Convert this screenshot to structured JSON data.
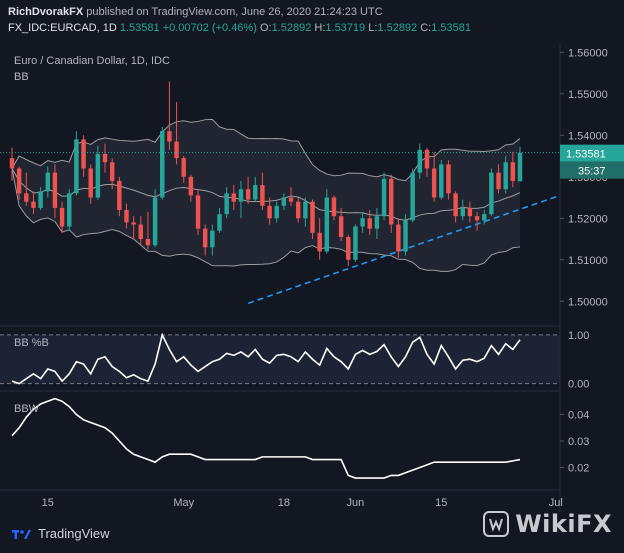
{
  "header": {
    "author": "RichDvorakFX",
    "published": "published on TradingView.com, June 26, 2020 21:24:23 UTC",
    "symbol": "FX_IDC:EURCAD, 1D",
    "last": "1.53581",
    "change": "+0.00702 (+0.46%)",
    "o_label": "O:",
    "o": "1.52892",
    "h_label": "H:",
    "h": "1.53719",
    "l_label": "L:",
    "l": "1.52892",
    "c_label": "C:",
    "c": "1.53581"
  },
  "footer": {
    "brand": "TradingView",
    "watermark": "WikiFX"
  },
  "colors": {
    "up": "#26a69a",
    "down": "#ef5350",
    "bands": "#c8c8c8",
    "trend": "#2196f3",
    "price_tag": "#26a69a",
    "bg": "#131722"
  },
  "chart_data": [
    {
      "type": "candlestick",
      "title": "Euro / Canadian Dollar, 1D, IDC",
      "indicator": "BB",
      "ylim": [
        1.495,
        1.562
      ],
      "yticks": [
        "1.56000",
        "1.55000",
        "1.54000",
        "1.53000",
        "1.52000",
        "1.51000",
        "1.50000"
      ],
      "last_price_label": "1.53581",
      "countdown_label": "35:37",
      "x_tick_labels": [
        "15",
        "May",
        "18",
        "Jun",
        "15",
        "Jul"
      ],
      "ohlc": [
        [
          1.5345,
          1.537,
          1.529,
          1.532
        ],
        [
          1.532,
          1.5325,
          1.5245,
          1.526
        ],
        [
          1.526,
          1.531,
          1.523,
          1.524
        ],
        [
          1.524,
          1.5265,
          1.521,
          1.5225
        ],
        [
          1.5225,
          1.5275,
          1.522,
          1.5265
        ],
        [
          1.5265,
          1.5325,
          1.525,
          1.531
        ],
        [
          1.531,
          1.533,
          1.52,
          1.5225
        ],
        [
          1.5225,
          1.524,
          1.5165,
          1.518
        ],
        [
          1.518,
          1.527,
          1.517,
          1.526
        ],
        [
          1.526,
          1.541,
          1.5255,
          1.539
        ],
        [
          1.539,
          1.54,
          1.53,
          1.532
        ],
        [
          1.532,
          1.533,
          1.5235,
          1.525
        ],
        [
          1.525,
          1.5375,
          1.5245,
          1.5355
        ],
        [
          1.5355,
          1.538,
          1.531,
          1.5335
        ],
        [
          1.5335,
          1.5345,
          1.527,
          1.529
        ],
        [
          1.529,
          1.53,
          1.5205,
          1.522
        ],
        [
          1.522,
          1.5235,
          1.5175,
          1.519
        ],
        [
          1.519,
          1.5205,
          1.515,
          1.5185
        ],
        [
          1.5185,
          1.5205,
          1.5135,
          1.515
        ],
        [
          1.515,
          1.5215,
          1.5125,
          1.5135
        ],
        [
          1.5135,
          1.527,
          1.513,
          1.525
        ],
        [
          1.525,
          1.542,
          1.5245,
          1.541
        ],
        [
          1.541,
          1.553,
          1.5365,
          1.5385
        ],
        [
          1.5385,
          1.548,
          1.533,
          1.5345
        ],
        [
          1.5345,
          1.535,
          1.5285,
          1.53
        ],
        [
          1.53,
          1.5305,
          1.524,
          1.5255
        ],
        [
          1.5255,
          1.527,
          1.516,
          1.5175
        ],
        [
          1.5175,
          1.5185,
          1.511,
          1.513
        ],
        [
          1.513,
          1.5185,
          1.511,
          1.517
        ],
        [
          1.517,
          1.5225,
          1.5165,
          1.521
        ],
        [
          1.521,
          1.5275,
          1.52,
          1.526
        ],
        [
          1.526,
          1.528,
          1.522,
          1.524
        ],
        [
          1.524,
          1.529,
          1.52,
          1.527
        ],
        [
          1.527,
          1.53,
          1.5235,
          1.5245
        ],
        [
          1.5245,
          1.53,
          1.524,
          1.528
        ],
        [
          1.528,
          1.531,
          1.522,
          1.523
        ],
        [
          1.523,
          1.525,
          1.5185,
          1.52
        ],
        [
          1.52,
          1.524,
          1.519,
          1.523
        ],
        [
          1.523,
          1.526,
          1.522,
          1.525
        ],
        [
          1.525,
          1.5275,
          1.523,
          1.524
        ],
        [
          1.524,
          1.525,
          1.519,
          1.52
        ],
        [
          1.52,
          1.525,
          1.518,
          1.524
        ],
        [
          1.524,
          1.5245,
          1.515,
          1.5165
        ],
        [
          1.5165,
          1.52,
          1.51,
          1.512
        ],
        [
          1.512,
          1.527,
          1.5115,
          1.525
        ],
        [
          1.525,
          1.5255,
          1.5195,
          1.5205
        ],
        [
          1.5205,
          1.5225,
          1.5145,
          1.5155
        ],
        [
          1.5155,
          1.516,
          1.5085,
          1.51
        ],
        [
          1.51,
          1.5185,
          1.5095,
          1.518
        ],
        [
          1.518,
          1.5215,
          1.5165,
          1.52
        ],
        [
          1.52,
          1.522,
          1.516,
          1.5175
        ],
        [
          1.5175,
          1.5225,
          1.515,
          1.5205
        ],
        [
          1.5205,
          1.531,
          1.5195,
          1.5295
        ],
        [
          1.5295,
          1.5305,
          1.5165,
          1.5185
        ],
        [
          1.5185,
          1.52,
          1.5105,
          1.512
        ],
        [
          1.512,
          1.521,
          1.511,
          1.5195
        ],
        [
          1.5195,
          1.532,
          1.519,
          1.531
        ],
        [
          1.531,
          1.538,
          1.5295,
          1.5365
        ],
        [
          1.5365,
          1.537,
          1.53,
          1.532
        ],
        [
          1.532,
          1.536,
          1.524,
          1.525
        ],
        [
          1.525,
          1.534,
          1.5245,
          1.533
        ],
        [
          1.533,
          1.534,
          1.5245,
          1.526
        ],
        [
          1.526,
          1.5265,
          1.519,
          1.5205
        ],
        [
          1.5205,
          1.5245,
          1.5195,
          1.5225
        ],
        [
          1.5225,
          1.524,
          1.519,
          1.5205
        ],
        [
          1.5205,
          1.5215,
          1.517,
          1.5195
        ],
        [
          1.5195,
          1.522,
          1.5185,
          1.521
        ],
        [
          1.521,
          1.532,
          1.5205,
          1.531
        ],
        [
          1.531,
          1.533,
          1.526,
          1.527
        ],
        [
          1.527,
          1.535,
          1.526,
          1.5335
        ],
        [
          1.5335,
          1.536,
          1.5275,
          1.529
        ],
        [
          1.5289,
          1.5372,
          1.5289,
          1.5358
        ]
      ]
    },
    {
      "type": "line",
      "indicator": "BB %B",
      "ylim": [
        -0.05,
        1.08
      ],
      "yticks": [
        "1.00",
        "0.00"
      ],
      "values": [
        0.05,
        0.0,
        0.1,
        0.2,
        0.1,
        0.3,
        0.25,
        0.05,
        0.2,
        0.45,
        0.4,
        0.2,
        0.5,
        0.55,
        0.35,
        0.25,
        0.12,
        0.18,
        0.1,
        0.05,
        0.4,
        1.0,
        0.7,
        0.45,
        0.55,
        0.38,
        0.25,
        0.35,
        0.45,
        0.5,
        0.62,
        0.58,
        0.65,
        0.55,
        0.7,
        0.5,
        0.42,
        0.58,
        0.6,
        0.55,
        0.45,
        0.65,
        0.5,
        0.38,
        0.72,
        0.55,
        0.45,
        0.3,
        0.6,
        0.68,
        0.6,
        0.66,
        0.8,
        0.55,
        0.35,
        0.55,
        0.85,
        0.95,
        0.6,
        0.4,
        0.78,
        0.55,
        0.3,
        0.48,
        0.5,
        0.45,
        0.52,
        0.78,
        0.6,
        0.82,
        0.7,
        0.9
      ]
    },
    {
      "type": "line",
      "indicator": "BBW",
      "ylim": [
        0.013,
        0.047
      ],
      "yticks": [
        "0.04",
        "0.03",
        "0.02"
      ],
      "values": [
        0.032,
        0.035,
        0.039,
        0.042,
        0.044,
        0.045,
        0.046,
        0.045,
        0.043,
        0.04,
        0.038,
        0.037,
        0.036,
        0.035,
        0.033,
        0.03,
        0.027,
        0.025,
        0.024,
        0.023,
        0.022,
        0.024,
        0.025,
        0.025,
        0.025,
        0.025,
        0.024,
        0.023,
        0.023,
        0.023,
        0.023,
        0.023,
        0.023,
        0.023,
        0.023,
        0.024,
        0.024,
        0.024,
        0.024,
        0.024,
        0.024,
        0.024,
        0.023,
        0.023,
        0.023,
        0.023,
        0.023,
        0.017,
        0.016,
        0.016,
        0.016,
        0.016,
        0.016,
        0.017,
        0.017,
        0.018,
        0.019,
        0.02,
        0.021,
        0.022,
        0.022,
        0.022,
        0.022,
        0.022,
        0.022,
        0.022,
        0.022,
        0.022,
        0.022,
        0.022,
        0.0225,
        0.023
      ]
    }
  ]
}
